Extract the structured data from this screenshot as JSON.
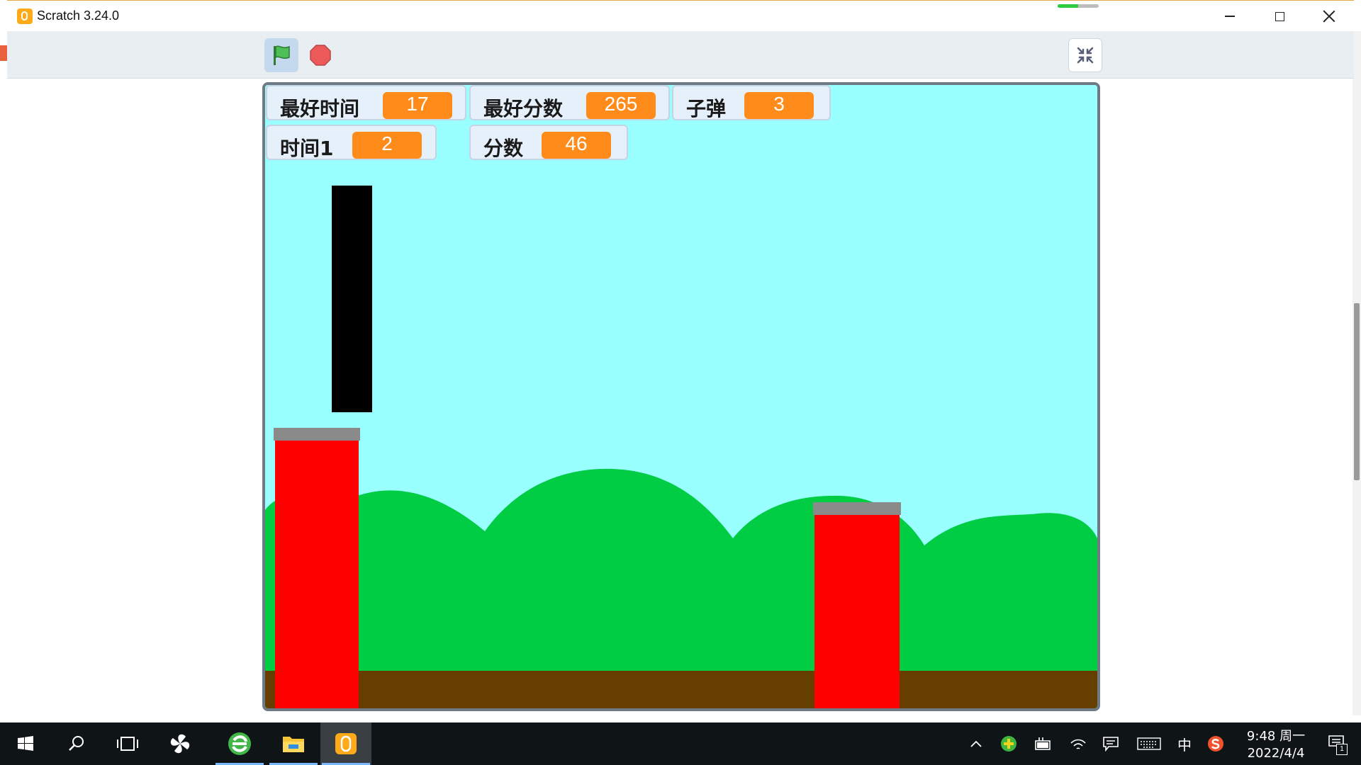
{
  "window": {
    "title": "Scratch 3.24.0",
    "loading_progress": 0.5
  },
  "toolbar": {
    "green_flag_icon": "green-flag-icon",
    "stop_icon": "stop-sign-icon",
    "fullscreen_icon": "exit-fullscreen-icon"
  },
  "stage": {
    "background_color": "#99ffff",
    "hills_color": "#00cc44",
    "ground_color": "#663f00",
    "pillar_color": "#ff0000",
    "pillar_cap_color": "#8a8a8a",
    "player_color": "#000000",
    "monitors": [
      {
        "label": "最好时间",
        "value": "17"
      },
      {
        "label": "最好分数",
        "value": "265"
      },
      {
        "label": "子弹",
        "value": "3"
      },
      {
        "label": "时间1",
        "value": "2"
      },
      {
        "label": "分数",
        "value": "46"
      }
    ]
  },
  "taskbar": {
    "icons": [
      "windows-start-icon",
      "search-icon",
      "task-view-icon",
      "pinwheel-app-icon",
      "browser-icon",
      "file-explorer-icon",
      "scratch-icon"
    ],
    "tray": {
      "ime": "中",
      "time": "9:48 周一",
      "date": "2022/4/4",
      "notification_count": "1"
    }
  },
  "colors": {
    "accent": "#ff8c1a",
    "monitor_bg": "#e6f0fa",
    "stage_border": "#6f7a87"
  }
}
